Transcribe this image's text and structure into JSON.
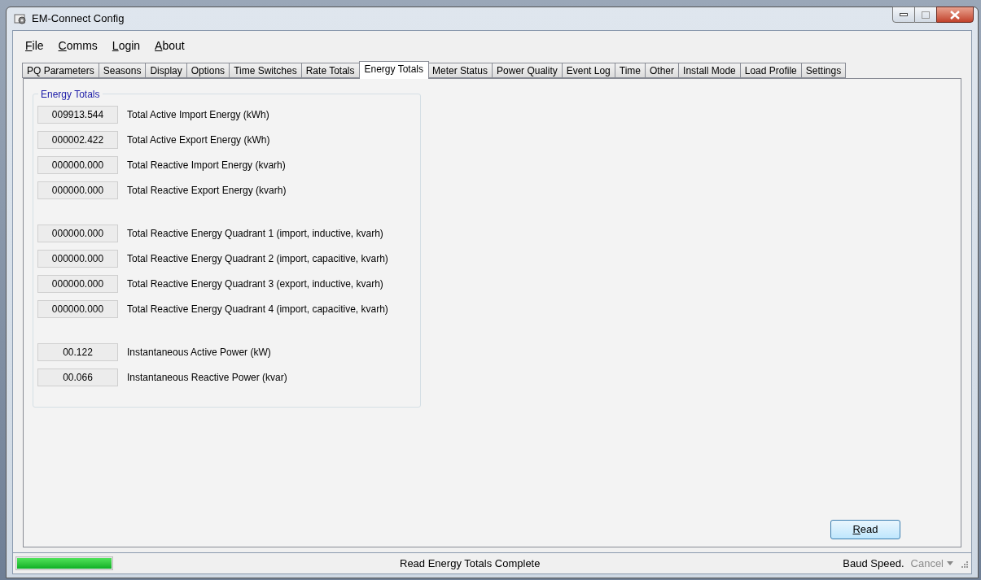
{
  "window": {
    "title": "EM-Connect Config"
  },
  "menu": [
    {
      "label": "File",
      "underline_first": true
    },
    {
      "label": "Comms",
      "underline_first": true
    },
    {
      "label": "Login",
      "underline_first": true
    },
    {
      "label": "About",
      "underline_first": true
    }
  ],
  "tabs": [
    {
      "label": "PQ Parameters",
      "selected": false
    },
    {
      "label": "Seasons",
      "selected": false
    },
    {
      "label": "Display",
      "selected": false
    },
    {
      "label": "Options",
      "selected": false
    },
    {
      "label": "Time Switches",
      "selected": false
    },
    {
      "label": "Rate Totals",
      "selected": false
    },
    {
      "label": "Energy Totals",
      "selected": true
    },
    {
      "label": "Meter Status",
      "selected": false
    },
    {
      "label": "Power Quality",
      "selected": false
    },
    {
      "label": "Event Log",
      "selected": false
    },
    {
      "label": "Time",
      "selected": false
    },
    {
      "label": "Other",
      "selected": false
    },
    {
      "label": "Install Mode",
      "selected": false
    },
    {
      "label": "Load Profile",
      "selected": false
    },
    {
      "label": "Settings",
      "selected": false
    }
  ],
  "group": {
    "title": "Energy Totals",
    "sections": [
      [
        {
          "value": "009913.544",
          "label": "Total Active Import Energy (kWh)"
        },
        {
          "value": "000002.422",
          "label": "Total Active Export Energy (kWh)"
        },
        {
          "value": "000000.000",
          "label": "Total Reactive Import Energy (kvarh)"
        },
        {
          "value": "000000.000",
          "label": "Total Reactive Export Energy (kvarh)"
        }
      ],
      [
        {
          "value": "000000.000",
          "label": "Total Reactive Energy Quadrant 1 (import, inductive, kvarh)"
        },
        {
          "value": "000000.000",
          "label": "Total Reactive Energy Quadrant 2 (import, capacitive, kvarh)"
        },
        {
          "value": "000000.000",
          "label": "Total Reactive Energy Quadrant 3 (export, inductive, kvarh)"
        },
        {
          "value": "000000.000",
          "label": "Total Reactive Energy Quadrant 4 (import, capacitive, kvarh)"
        }
      ],
      [
        {
          "value": "00.122",
          "label": "Instantaneous Active Power (kW)"
        },
        {
          "value": "00.066",
          "label": "Instantaneous Reactive Power (kvar)"
        }
      ]
    ]
  },
  "read_button": {
    "label": "Read",
    "underline_first": true
  },
  "status_bar": {
    "progress": {
      "level": 1
    },
    "message": "Read Energy Totals Complete",
    "baud": "Baud Speed.",
    "cancel": {
      "label": "Cancel",
      "disabled": true
    }
  }
}
